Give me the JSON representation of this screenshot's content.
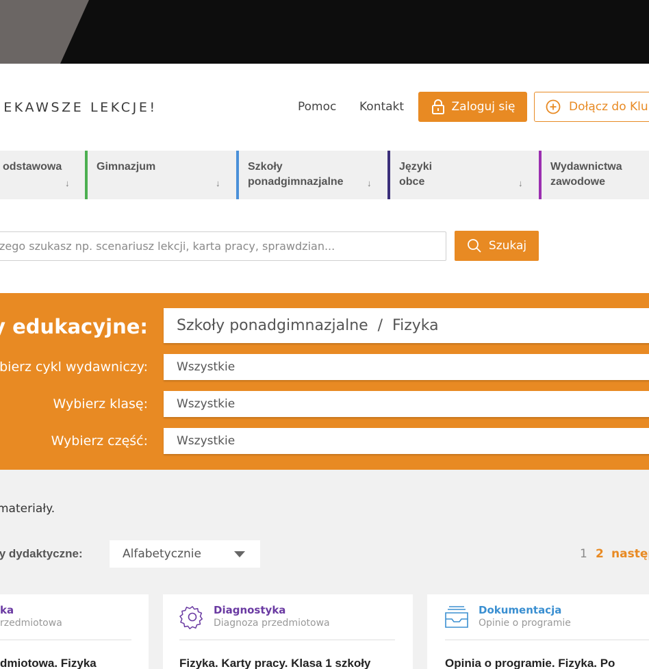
{
  "header": {
    "tagline": "IEKAWSZE LEKCJE!",
    "nav": [
      "Pomoc",
      "Kontakt"
    ],
    "login_label": "Zaloguj się",
    "join_label": "Dołącz do Klu"
  },
  "tabs": [
    {
      "label_lines": [
        "odstawowa",
        ""
      ],
      "color": ""
    },
    {
      "label_lines": [
        "Gimnazjum",
        ""
      ],
      "color": "#4caf50"
    },
    {
      "label_lines": [
        "Szkoły",
        "ponadgimnazjalne"
      ],
      "color": "#4a90d9"
    },
    {
      "label_lines": [
        "Języki",
        "obce"
      ],
      "color": "#3b2f7a"
    },
    {
      "label_lines": [
        "Wydawnictwa",
        "zawodowe"
      ],
      "color": "#9b2fb0"
    }
  ],
  "search": {
    "placeholder": "zego szukasz np. scenariusz lekcji, karta pracy, sprawdzian...",
    "button_label": "Szukaj"
  },
  "filters": {
    "title": "by edukacyjne:",
    "selected_path": "Szkoły ponadgimnazjalne  /  Fizyka",
    "cycle_label": "ybierz cykl wydawniczy:",
    "cycle_value": "Wszystkie",
    "class_label": "Wybierz klasę:",
    "class_value": "Wszystkie",
    "part_label": "Wybierz część:",
    "part_value": "Wszystkie"
  },
  "results": {
    "info": "materiały.",
    "sort_label": "ły dydaktyczne:",
    "sort_value": "Alfabetycznie",
    "pages": [
      "1",
      "2"
    ],
    "next_label": "następ"
  },
  "cards": [
    {
      "title": "ka",
      "subtitle": "rzedmiotowa",
      "heading": "dmiotowa. Fizyka",
      "title_color": "#6a3aa2"
    },
    {
      "title": "Diagnostyka",
      "subtitle": "Diagnoza przedmiotowa",
      "heading": "Fizyka. Karty pracy. Klasa 1 szkoły",
      "title_color": "#6a3aa2",
      "icon": "gear-icon"
    },
    {
      "title": "Dokumentacja",
      "subtitle": "Opinie o programie",
      "heading": "Opinia o programie. Fizyka. Po",
      "title_color": "#3a8fd1",
      "icon": "inbox-tray-icon"
    }
  ],
  "colors": {
    "accent": "#e88a23",
    "dark": "#0d0d0d"
  }
}
